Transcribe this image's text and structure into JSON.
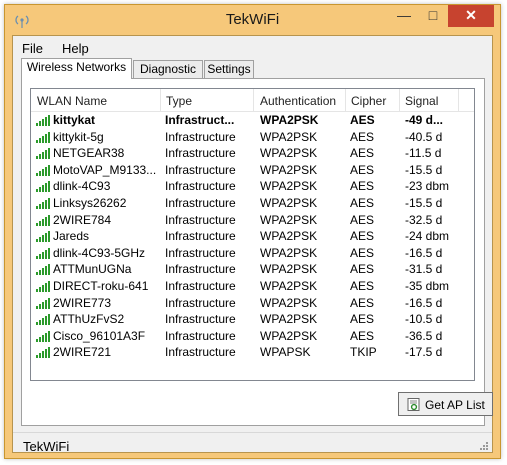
{
  "window": {
    "title": "TekWiFi",
    "close_glyph": "✕",
    "minimize_glyph": "—",
    "maximize_glyph": "□",
    "icon": "wifi-antenna-icon"
  },
  "menu": [
    "File",
    "Help"
  ],
  "tabs": [
    {
      "label": "Wireless Networks",
      "active": true
    },
    {
      "label": "Diagnostic",
      "active": false
    },
    {
      "label": "Settings",
      "active": false
    }
  ],
  "table": {
    "columns": [
      "WLAN Name",
      "Type",
      "Authentication",
      "Cipher",
      "Signal"
    ],
    "rows": [
      {
        "name": "kittykat",
        "type": "Infrastruct...",
        "auth": "WPA2PSK",
        "cipher": "AES",
        "signal": "-49 d...",
        "bold": true
      },
      {
        "name": "kittykit-5g",
        "type": "Infrastructure",
        "auth": "WPA2PSK",
        "cipher": "AES",
        "signal": "-40.5 d"
      },
      {
        "name": "NETGEAR38",
        "type": "Infrastructure",
        "auth": "WPA2PSK",
        "cipher": "AES",
        "signal": "-11.5 d"
      },
      {
        "name": "MotoVAP_M9133...",
        "type": "Infrastructure",
        "auth": "WPA2PSK",
        "cipher": "AES",
        "signal": "-15.5 d"
      },
      {
        "name": "dlink-4C93",
        "type": "Infrastructure",
        "auth": "WPA2PSK",
        "cipher": "AES",
        "signal": "-23 dbm"
      },
      {
        "name": "Linksys26262",
        "type": "Infrastructure",
        "auth": "WPA2PSK",
        "cipher": "AES",
        "signal": "-15.5 d"
      },
      {
        "name": "2WIRE784",
        "type": "Infrastructure",
        "auth": "WPA2PSK",
        "cipher": "AES",
        "signal": "-32.5 d"
      },
      {
        "name": "Jareds",
        "type": "Infrastructure",
        "auth": "WPA2PSK",
        "cipher": "AES",
        "signal": "-24 dbm"
      },
      {
        "name": "dlink-4C93-5GHz",
        "type": "Infrastructure",
        "auth": "WPA2PSK",
        "cipher": "AES",
        "signal": "-16.5 d"
      },
      {
        "name": "ATTMunUGNa",
        "type": "Infrastructure",
        "auth": "WPA2PSK",
        "cipher": "AES",
        "signal": "-31.5 d"
      },
      {
        "name": "DIRECT-roku-641",
        "type": "Infrastructure",
        "auth": "WPA2PSK",
        "cipher": "AES",
        "signal": "-35 dbm"
      },
      {
        "name": "2WIRE773",
        "type": "Infrastructure",
        "auth": "WPA2PSK",
        "cipher": "AES",
        "signal": "-16.5 d"
      },
      {
        "name": "ATThUzFvS2",
        "type": "Infrastructure",
        "auth": "WPA2PSK",
        "cipher": "AES",
        "signal": "-10.5 d"
      },
      {
        "name": "Cisco_96101A3F",
        "type": "Infrastructure",
        "auth": "WPA2PSK",
        "cipher": "AES",
        "signal": "-36.5 d"
      },
      {
        "name": "2WIRE721",
        "type": "Infrastructure",
        "auth": "WPAPSK",
        "cipher": "TKIP",
        "signal": "-17.5 d"
      }
    ]
  },
  "ap_button": {
    "label": "Get AP List",
    "icon": "refresh-list-icon"
  },
  "status_text": "TekWiFi",
  "colors": {
    "frame": "#f6c87a",
    "close": "#c7432f",
    "signal": "#2b9a2b"
  }
}
